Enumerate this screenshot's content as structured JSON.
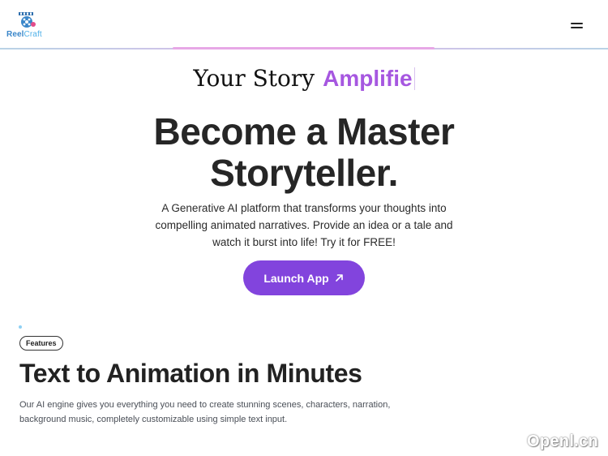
{
  "header": {
    "logo_part1": "Reel",
    "logo_part2": "Craft",
    "menu_icon": "hamburger-menu-icon"
  },
  "hero": {
    "tagline_plain": "Your Story",
    "tagline_animated": "Amplifie",
    "title_line1": "Become a Master",
    "title_line2": "Storyteller.",
    "description": "A Generative AI platform that transforms your thoughts into compelling animated narratives. Provide an idea or a tale and watch it burst into life! Try it for FREE!",
    "cta_label": "Launch App",
    "cta_icon": "arrow-up-right-icon"
  },
  "features": {
    "badge": "Features",
    "title": "Text to Animation in Minutes",
    "description": "Our AI engine gives you everything you need to create stunning scenes, characters, narration, background music, completely customizable using simple text input."
  },
  "watermark": "Openl.cn",
  "colors": {
    "accent_purple": "#8244dd",
    "tagline_purple": "#a657e0",
    "logo_blue": "#3a86c9"
  }
}
